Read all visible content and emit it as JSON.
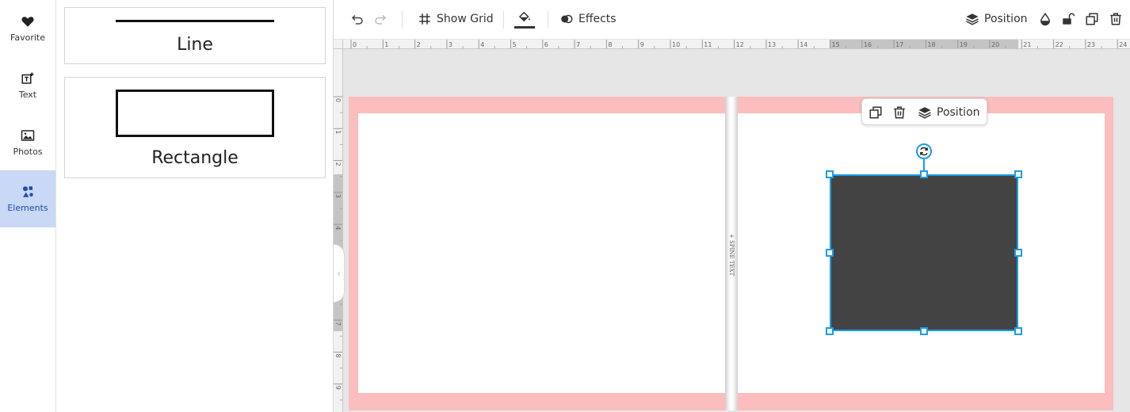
{
  "nav": {
    "items": [
      {
        "label": "Favorite",
        "icon": "heart-icon"
      },
      {
        "label": "Text",
        "icon": "text-add-icon"
      },
      {
        "label": "Photos",
        "icon": "image-icon"
      },
      {
        "label": "Elements",
        "icon": "shapes-icon",
        "active": true
      }
    ]
  },
  "panel": {
    "cards": [
      {
        "label": "Line"
      },
      {
        "label": "Rectangle"
      }
    ]
  },
  "toolbar": {
    "show_grid": "Show Grid",
    "effects": "Effects",
    "position": "Position"
  },
  "ruler": {
    "top_ticks": [
      "0",
      "1",
      "2",
      "3",
      "4",
      "5",
      "6",
      "7",
      "8",
      "9",
      "10",
      "11",
      "12",
      "13",
      "14",
      "15",
      "16",
      "17",
      "18",
      "19",
      "20",
      "21",
      "22",
      "23",
      "24"
    ],
    "left_ticks": [
      "0",
      "1",
      "2",
      "3",
      "4",
      "5",
      "6",
      "7",
      "8",
      "9"
    ]
  },
  "canvas": {
    "spine_text": "+ SPINE TEXT"
  },
  "context_menu": {
    "position": "Position"
  },
  "colors": {
    "accent": "#1a9ce8",
    "bleed": "#fbbdbd",
    "shape_fill": "#434343",
    "nav_active": "#c8d8f5"
  }
}
